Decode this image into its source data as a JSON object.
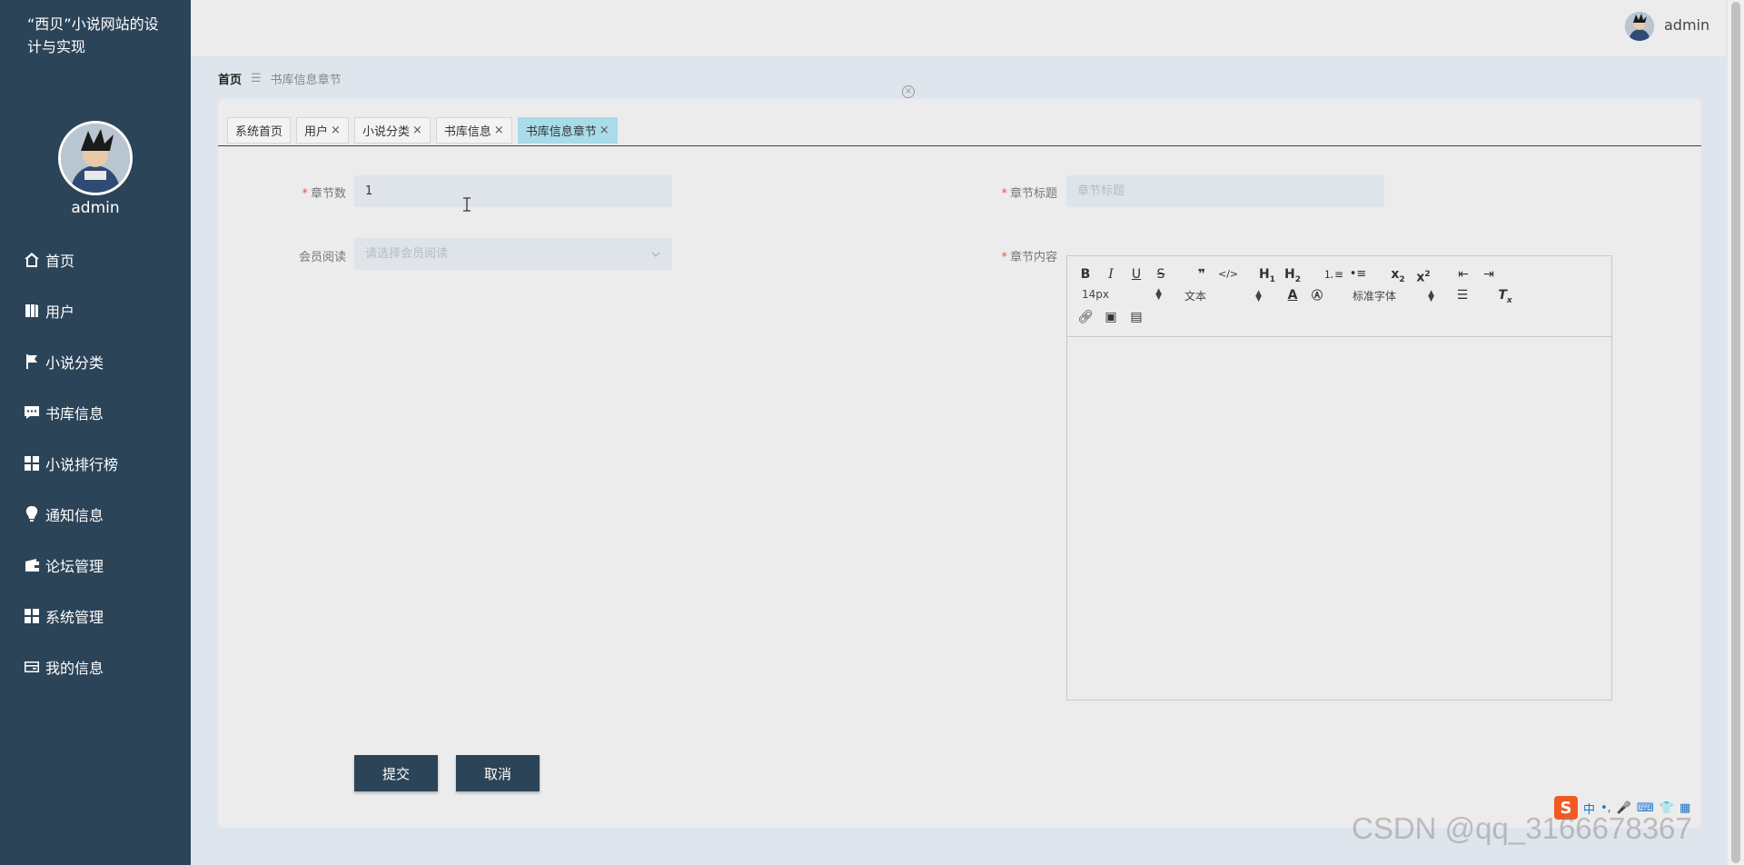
{
  "sidebar": {
    "site_title": "“西贝”小说网站的设计与实现",
    "username": "admin",
    "items": [
      {
        "label": "首页",
        "icon": "home-icon"
      },
      {
        "label": "用户",
        "icon": "book-icon"
      },
      {
        "label": "小说分类",
        "icon": "flag-icon"
      },
      {
        "label": "书库信息",
        "icon": "chat-icon"
      },
      {
        "label": "小说排行榜",
        "icon": "grid-icon"
      },
      {
        "label": "通知信息",
        "icon": "bulb-icon"
      },
      {
        "label": "论坛管理",
        "icon": "wallet-icon"
      },
      {
        "label": "系统管理",
        "icon": "grid-icon"
      },
      {
        "label": "我的信息",
        "icon": "card-icon"
      }
    ]
  },
  "topbar": {
    "username": "admin"
  },
  "breadcrumb": {
    "home": "首页",
    "separator": "☰",
    "current": "书库信息章节"
  },
  "tabs": [
    {
      "label": "系统首页",
      "closable": false,
      "active": false
    },
    {
      "label": "用户",
      "closable": true,
      "active": false
    },
    {
      "label": "小说分类",
      "closable": true,
      "active": false
    },
    {
      "label": "书库信息",
      "closable": true,
      "active": false
    },
    {
      "label": "书库信息章节",
      "closable": true,
      "active": true
    }
  ],
  "form": {
    "chapter_num": {
      "label": "章节数",
      "required": true,
      "value": "1"
    },
    "chapter_title": {
      "label": "章节标题",
      "required": true,
      "placeholder": "章节标题",
      "value": ""
    },
    "member_read": {
      "label": "会员阅读",
      "required": false,
      "placeholder": "请选择会员阅读"
    },
    "chapter_content": {
      "label": "章节内容",
      "required": true
    }
  },
  "editor": {
    "font_size": "14px",
    "header": "文本",
    "font_family": "标准字体"
  },
  "buttons": {
    "submit": "提交",
    "cancel": "取消"
  },
  "ime": {
    "logo": "S",
    "items": [
      "中",
      "•,",
      "🎤",
      "⌨",
      "👕",
      "▦"
    ]
  },
  "watermark": "CSDN @qq_3166678367",
  "colors": {
    "sidebar": "#2c4458",
    "active_tab": "#a9dce9",
    "required": "#e05b4c"
  }
}
